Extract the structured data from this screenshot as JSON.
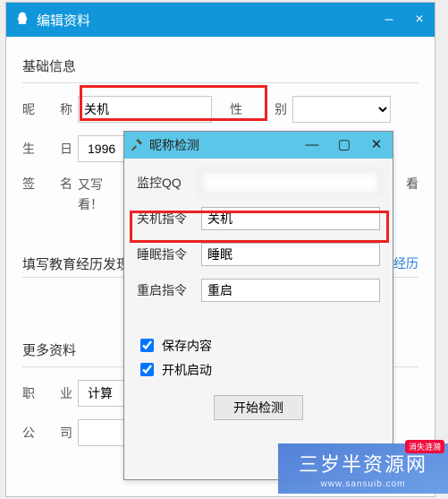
{
  "main": {
    "title": "编辑资料",
    "sections": {
      "basic": "基础信息",
      "edu_title": "填写教育经历发现",
      "edu_link_tail": "育经历",
      "more": "更多资料"
    },
    "fields": {
      "nick_label": "昵称",
      "nick_value": "关机",
      "gender_suffix": "性",
      "gender_label": "别",
      "birthday_label": "生日",
      "birthday_value": "1996",
      "sign_label": "签名",
      "sign_line1": "又写",
      "sign_line2": "看！",
      "view_btn": "看",
      "job_label": "职业",
      "job_value": "计算",
      "company_label": "公司"
    }
  },
  "dialog": {
    "title": "昵称检测",
    "monitor_label": "监控QQ",
    "monitor_value": "",
    "shutdown_label": "关机指令",
    "shutdown_value": "关机",
    "sleep_label": "睡眠指令",
    "sleep_value": "睡眠",
    "restart_label": "重启指令",
    "restart_value": "重启",
    "save_content": "保存内容",
    "autostart": "开机启动",
    "start_btn": "开始检测"
  },
  "watermark": {
    "badge": "消失涟漪",
    "text": "三岁半资源网",
    "url": "www.sansuib.com"
  }
}
